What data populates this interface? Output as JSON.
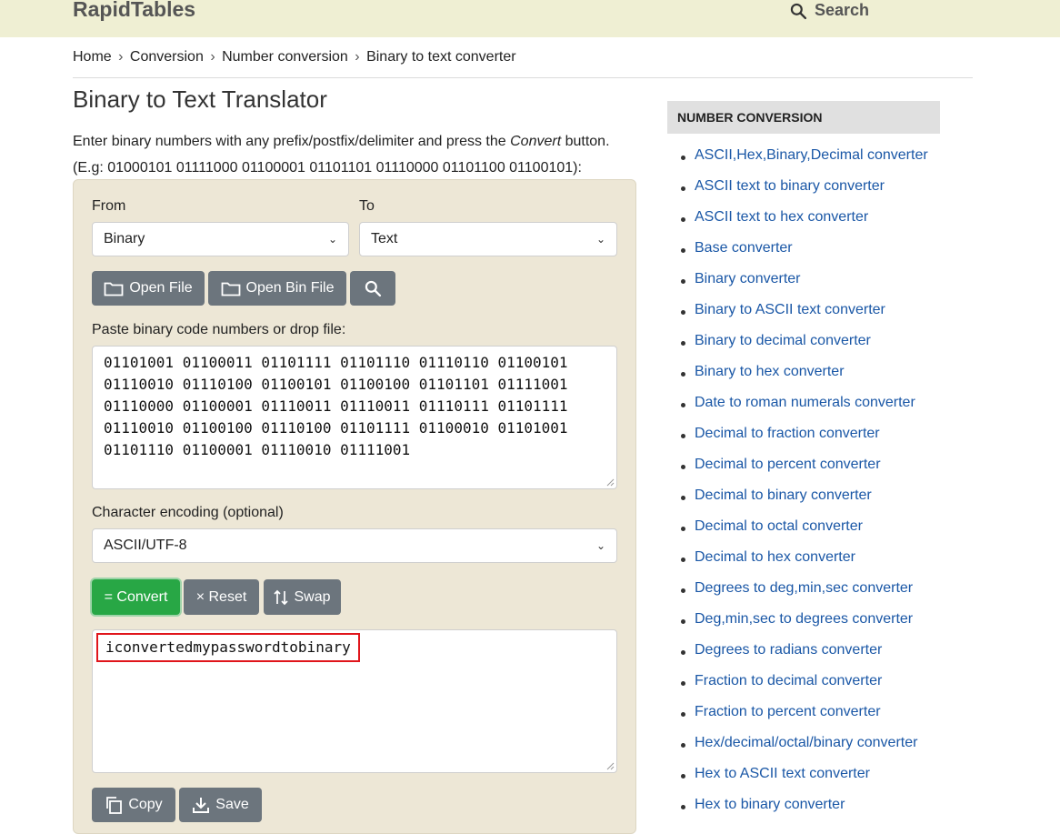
{
  "header": {
    "logo": "RapidTables",
    "search_label": "Search"
  },
  "breadcrumb": [
    {
      "label": "Home"
    },
    {
      "label": "Conversion"
    },
    {
      "label": "Number conversion"
    },
    {
      "label": "Binary to text converter"
    }
  ],
  "page": {
    "title": "Binary to Text Translator",
    "intro_before": "Enter binary numbers with any prefix/postfix/delimiter and press the ",
    "intro_em": "Convert",
    "intro_after": " button.",
    "example": "(E.g: 01000101 01111000 01100001 01101101 01110000 01101100 01100101):"
  },
  "form": {
    "from_label": "From",
    "from_value": "Binary",
    "to_label": "To",
    "to_value": "Text",
    "open_file": "Open File",
    "open_bin_file": "Open Bin File",
    "input_label": "Paste binary code numbers or drop file:",
    "input_lines": [
      "01101001 01100011 01101111 01101110 01110110 01100101",
      "01110010 01110100 01100101 01100100 01101101 01111001",
      "01110000 01100001 01110011 01110011 01110111 01101111",
      "01110010 01100100 01110100 01101111 01100010 01101001",
      "01101110 01100001 01110010 01111001"
    ],
    "encoding_label": "Character encoding (optional)",
    "encoding_value": "ASCII/UTF-8",
    "convert": "= Convert",
    "reset": "× Reset",
    "swap": "Swap",
    "output": "iconvertedmypasswordtobinary",
    "copy": "Copy",
    "save": "Save",
    "highlight_color": "#e0151b"
  },
  "sidebar": {
    "heading": "NUMBER CONVERSION",
    "items": [
      "ASCII,Hex,Binary,Decimal converter",
      "ASCII text to binary converter",
      "ASCII text to hex converter",
      "Base converter",
      "Binary converter",
      "Binary to ASCII text converter",
      "Binary to decimal converter",
      "Binary to hex converter",
      "Date to roman numerals converter",
      "Decimal to fraction converter",
      "Decimal to percent converter",
      "Decimal to binary converter",
      "Decimal to octal converter",
      "Decimal to hex converter",
      "Degrees to deg,min,sec converter",
      "Deg,min,sec to degrees converter",
      "Degrees to radians converter",
      "Fraction to decimal converter",
      "Fraction to percent converter",
      "Hex/decimal/octal/binary converter",
      "Hex to ASCII text converter",
      "Hex to binary converter"
    ]
  }
}
